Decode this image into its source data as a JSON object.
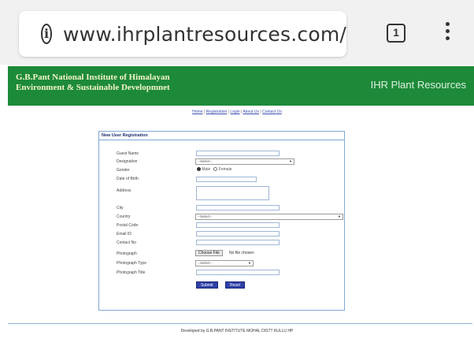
{
  "browser": {
    "url": "www.ihrplantresources.com/",
    "tab_count": "1"
  },
  "banner": {
    "title_line1": "G.B.Pant National Institute of Himalayan",
    "title_line2": "Environment & Sustainable Developmnet",
    "site_name": "IHR Plant Resources",
    "color": "#1d8a3a"
  },
  "nav": {
    "items": [
      "Home",
      "Registration",
      "Login",
      "About Us",
      "Contact Us"
    ],
    "separator": "|"
  },
  "form": {
    "title": "New User Registration",
    "fields": {
      "guest_name": "Guest Name",
      "designation": "Designation",
      "gender": "Gender",
      "dob": "Date of Birth",
      "address": "Address",
      "city": "City",
      "country": "Country",
      "postal_code": "Postal Code",
      "email": "Email ID",
      "contact": "Contact No",
      "photograph": "Photograph",
      "photo_type": "Photograph Type",
      "photo_title": "Photograph Title"
    },
    "designation_value": "--Select--",
    "country_value": "--Select--",
    "photo_type_value": "--Select--",
    "gender_options": {
      "male": "Male",
      "female": "Female",
      "selected": "Male"
    },
    "file_button": "Choose File",
    "file_status": "No file chosen",
    "submit_label": "Submit",
    "reset_label": "Reset"
  },
  "footer": {
    "text": "Developed by G.B.PANT INSTITUTE MOHAL DISTT KULLU HP"
  }
}
